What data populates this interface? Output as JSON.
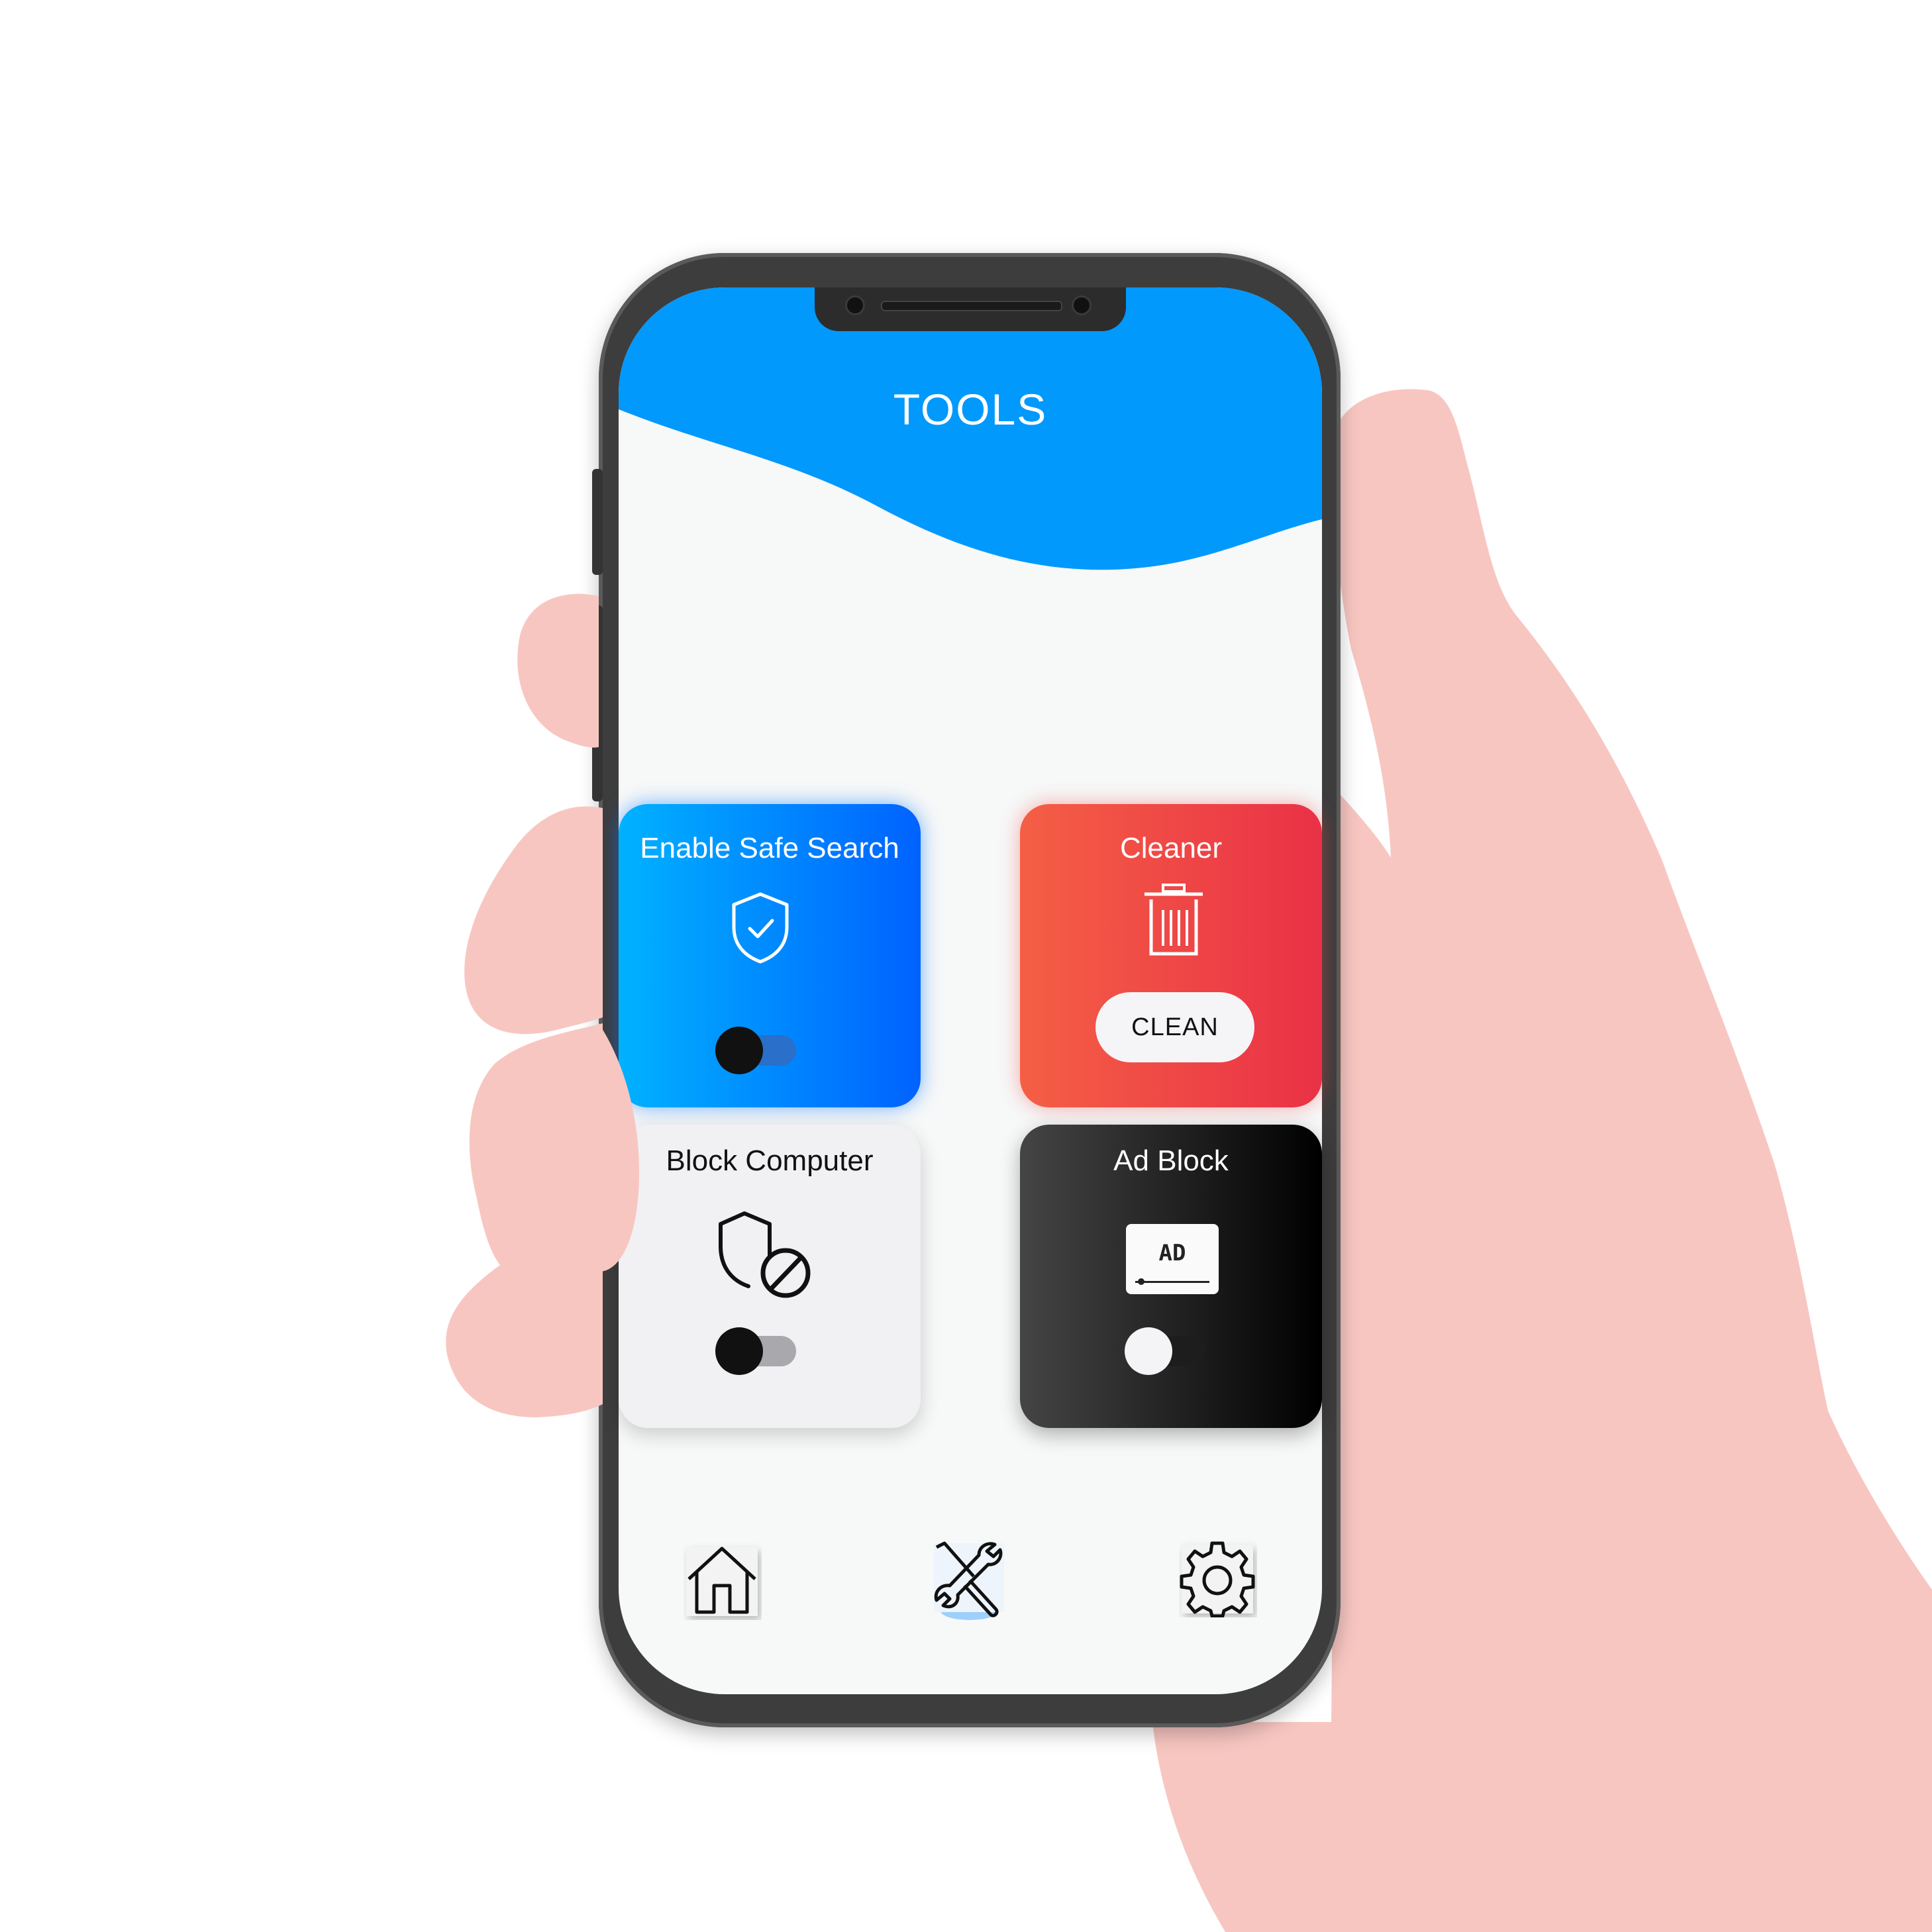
{
  "header": {
    "title": "TOOLS"
  },
  "cards": {
    "safe_search": {
      "label": "Enable Safe Search",
      "icon": "shield-check-icon",
      "toggle_on": false
    },
    "cleaner": {
      "label": "Cleaner",
      "icon": "trash-icon",
      "button_label": "CLEAN"
    },
    "block_computer": {
      "label": "Block Computer",
      "icon": "shield-block-icon",
      "toggle_on": false
    },
    "ad_block": {
      "label": "Ad Block",
      "icon": "ad-icon",
      "badge_text": "AD",
      "toggle_on": false
    }
  },
  "nav": {
    "items": [
      {
        "name": "home",
        "icon": "home-icon",
        "active": false
      },
      {
        "name": "tools",
        "icon": "tools-icon",
        "active": true
      },
      {
        "name": "settings",
        "icon": "gear-icon",
        "active": false
      }
    ]
  },
  "colors": {
    "header_blue": "#0299fc",
    "safe_gradient": [
      "#00b2ff",
      "#0062ff"
    ],
    "cleaner_gradient": [
      "#f45f45",
      "#ea3146"
    ],
    "adblock_gradient": [
      "#454545",
      "#000000"
    ],
    "hand": "#f8c6c1"
  }
}
